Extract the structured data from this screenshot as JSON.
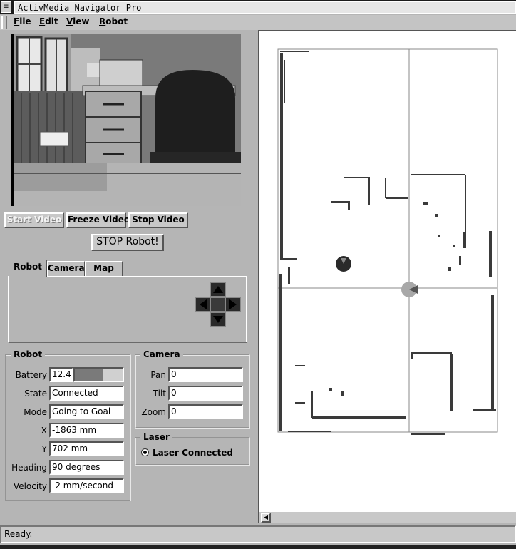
{
  "window": {
    "title": "ActivMedia Navigator Pro",
    "sysmenu_glyph": "≡"
  },
  "menubar": {
    "items": [
      "File",
      "Edit",
      "View",
      "Robot"
    ]
  },
  "video_controls": {
    "start": {
      "label": "Start Video",
      "enabled": false
    },
    "freeze": {
      "label": "Freeze Video"
    },
    "stop": {
      "label": "Stop Video"
    }
  },
  "stop_robot": {
    "label": "STOP Robot!"
  },
  "tabs": {
    "items": [
      "Robot",
      "Camera",
      "Map"
    ],
    "active": "Robot"
  },
  "dpad": {
    "icons": [
      "arrow-up-icon",
      "arrow-left-icon",
      "stop-square-icon",
      "arrow-right-icon",
      "arrow-down-icon"
    ]
  },
  "robot": {
    "title": "Robot",
    "battery": {
      "label": "Battery",
      "value": "12.4",
      "level": 0.6
    },
    "state": {
      "label": "State",
      "value": "Connected"
    },
    "mode": {
      "label": "Mode",
      "value": "Going to Goal"
    },
    "x": {
      "label": "X",
      "value": "-1863 mm"
    },
    "y": {
      "label": "Y",
      "value": "702 mm"
    },
    "heading": {
      "label": "Heading",
      "value": "90 degrees"
    },
    "velocity": {
      "label": "Velocity",
      "value": "-2 mm/second"
    }
  },
  "camera": {
    "title": "Camera",
    "pan": {
      "label": "Pan",
      "value": "0"
    },
    "tilt": {
      "label": "Tilt",
      "value": "0"
    },
    "zoom": {
      "label": "Zoom",
      "value": "0"
    }
  },
  "laser": {
    "title": "Laser",
    "status": "Laser Connected",
    "selected": true
  },
  "map": {
    "background": "#ffffff",
    "crosshair_color": "#8a8a8a",
    "robot_marker_color": "#2a2a2a",
    "goal_marker_color": "#a8a8a8"
  },
  "status": {
    "text": "Ready."
  }
}
